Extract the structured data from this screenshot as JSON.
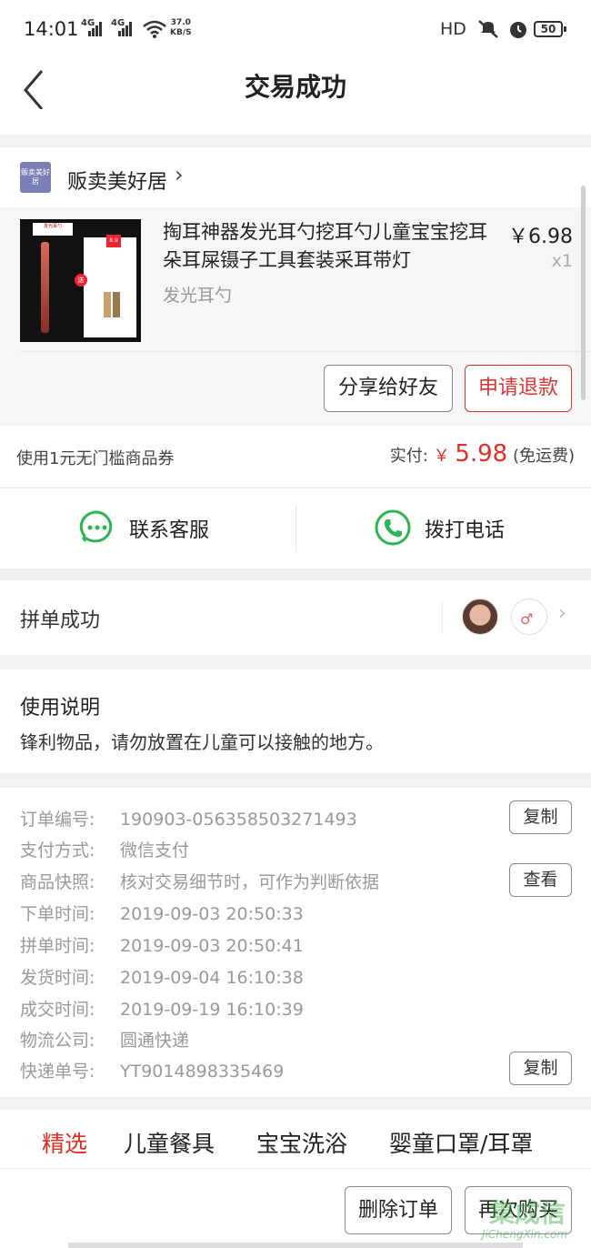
{
  "status_bar": {
    "time": "14:01",
    "net1": "4G",
    "net2": "4G",
    "speed_value": "37.0",
    "speed_unit": "KB/S",
    "hd": "HD",
    "battery": "50"
  },
  "nav": {
    "title": "交易成功"
  },
  "shop": {
    "logo_text": "贩卖美好居",
    "name": "贩卖美好居"
  },
  "product": {
    "title": "掏耳神器发光耳勺挖耳勺儿童宝宝挖耳朵耳屎镊子工具套装采耳带灯",
    "spec": "发光耳勺",
    "price": "￥6.98",
    "qty": "x1",
    "image_tag": "发光耳勺",
    "image_gift": "送",
    "image_badge": "8.9",
    "share_label": "分享给好友",
    "refund_label": "申请退款"
  },
  "payment": {
    "coupon": "使用1元无门槛商品券",
    "paid_label": "实付:",
    "currency": "￥",
    "amount": "5.98",
    "shipping_note": "(免运费)"
  },
  "contact": {
    "service_label": "联系客服",
    "phone_label": "拨打电话"
  },
  "group": {
    "label": "拼单成功"
  },
  "usage": {
    "title": "使用说明",
    "text": "锋利物品，请勿放置在儿童可以接触的地方。"
  },
  "details": {
    "rows": [
      {
        "key": "订单编号:",
        "value": "190903-056358503271493"
      },
      {
        "key": "支付方式:",
        "value": "微信支付"
      },
      {
        "key": "商品快照:",
        "value": "核对交易细节时，可作为判断依据"
      },
      {
        "key": "下单时间:",
        "value": "2019-09-03 20:50:33"
      },
      {
        "key": "拼单时间:",
        "value": "2019-09-03 20:50:41"
      },
      {
        "key": "发货时间:",
        "value": "2019-09-04 16:10:38"
      },
      {
        "key": "成交时间:",
        "value": "2019-09-19 16:10:39"
      },
      {
        "key": "物流公司:",
        "value": "圆通快递"
      },
      {
        "key": "快递单号:",
        "value": "YT9014898335469"
      }
    ],
    "copy_label": "复制",
    "view_label": "查看"
  },
  "tabs": [
    "精选",
    "儿童餐具",
    "宝宝洗浴",
    "婴童口罩/耳罩"
  ],
  "footer": {
    "delete_label": "删除订单",
    "rebuy_label": "再次购买"
  },
  "watermark": {
    "main": "集成信",
    "sub": "JiChengXin.com"
  },
  "colors": {
    "accent_red": "#e02e24",
    "wechat_green": "#2eb553"
  }
}
